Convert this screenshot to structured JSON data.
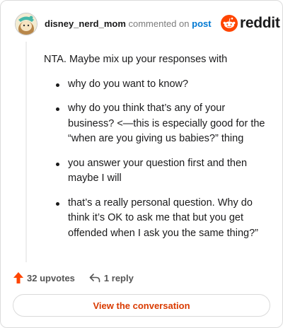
{
  "header": {
    "username": "disney_nerd_mom",
    "action_text": "commented on",
    "post_link": "post",
    "logo_text": "reddit"
  },
  "comment": {
    "intro": "NTA. Maybe mix up your responses with",
    "items": [
      "why do you want to know?",
      "why do you think that’s any of your business? <—this is especially good for the “when are you giving us babies?” thing",
      "you answer your question first and then maybe I will",
      "that’s a really personal question. Why do think it’s OK to ask me that but you get offended when I ask you the same thing?”"
    ]
  },
  "footer": {
    "upvotes": "32 upvotes",
    "replies": "1 reply",
    "button_label": "View the conversation"
  },
  "icons": {
    "upvote": "arrow-up-icon",
    "reply": "reply-arrow-icon",
    "avatar": "snoo-avatar",
    "logo": "reddit-snoo-logo"
  },
  "colors": {
    "brand": "#ff4500",
    "link": "#0079d3",
    "button_text": "#d93a00"
  }
}
